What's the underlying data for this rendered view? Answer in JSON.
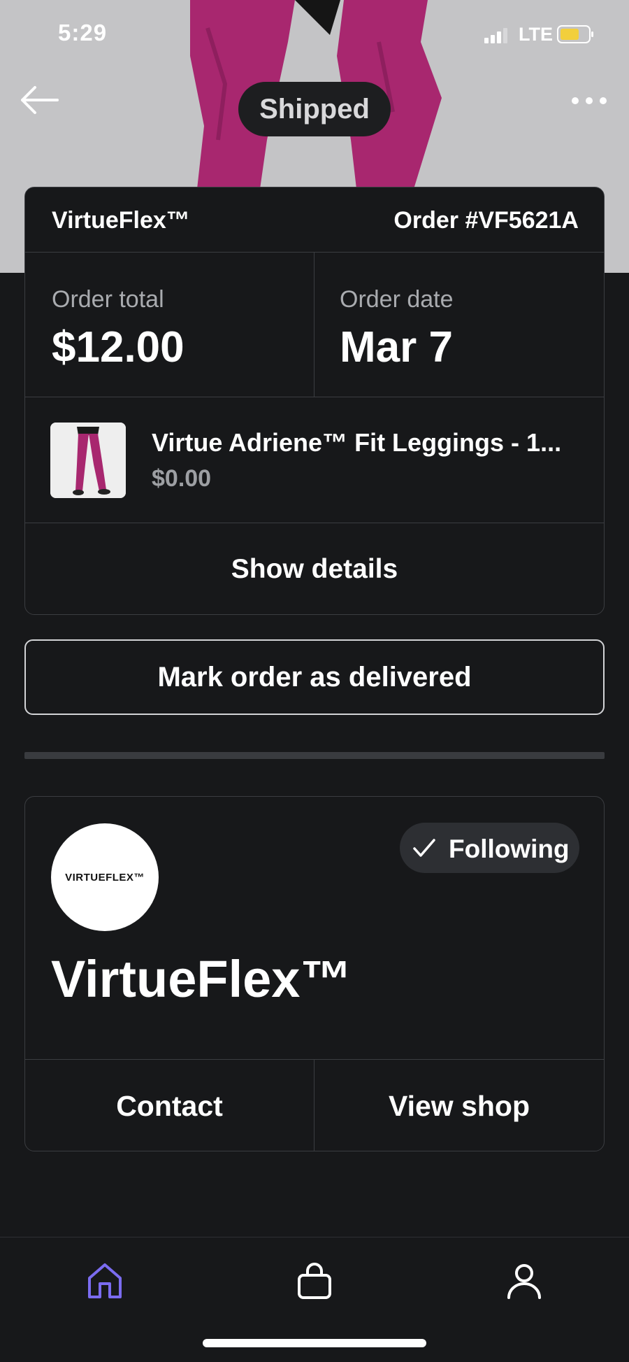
{
  "status_bar": {
    "time": "5:29",
    "network": "LTE",
    "battery_color": "#f2cf3c"
  },
  "hero": {
    "status_pill": "Shipped",
    "legging_color": "#a8276f"
  },
  "order": {
    "shop_name": "VirtueFlex™",
    "order_number": "Order #VF5621A",
    "total_label": "Order total",
    "total_value": "$12.00",
    "date_label": "Order date",
    "date_value": "Mar 7",
    "product": {
      "title": "Virtue Adriene™ Fit Leggings - 1...",
      "price": "$0.00"
    },
    "show_details_label": "Show details"
  },
  "mark_delivered_label": "Mark order as delivered",
  "shop": {
    "logo_text": "VIRTUEFLEX™",
    "following_label": "Following",
    "name": "VirtueFlex™",
    "contact_label": "Contact",
    "view_shop_label": "View shop"
  },
  "tab_bar": {
    "tabs": [
      {
        "icon": "home-icon",
        "active": true
      },
      {
        "icon": "shopping-bag-icon",
        "active": false
      },
      {
        "icon": "profile-icon",
        "active": false
      }
    ],
    "active_color": "#7b6cf0"
  }
}
